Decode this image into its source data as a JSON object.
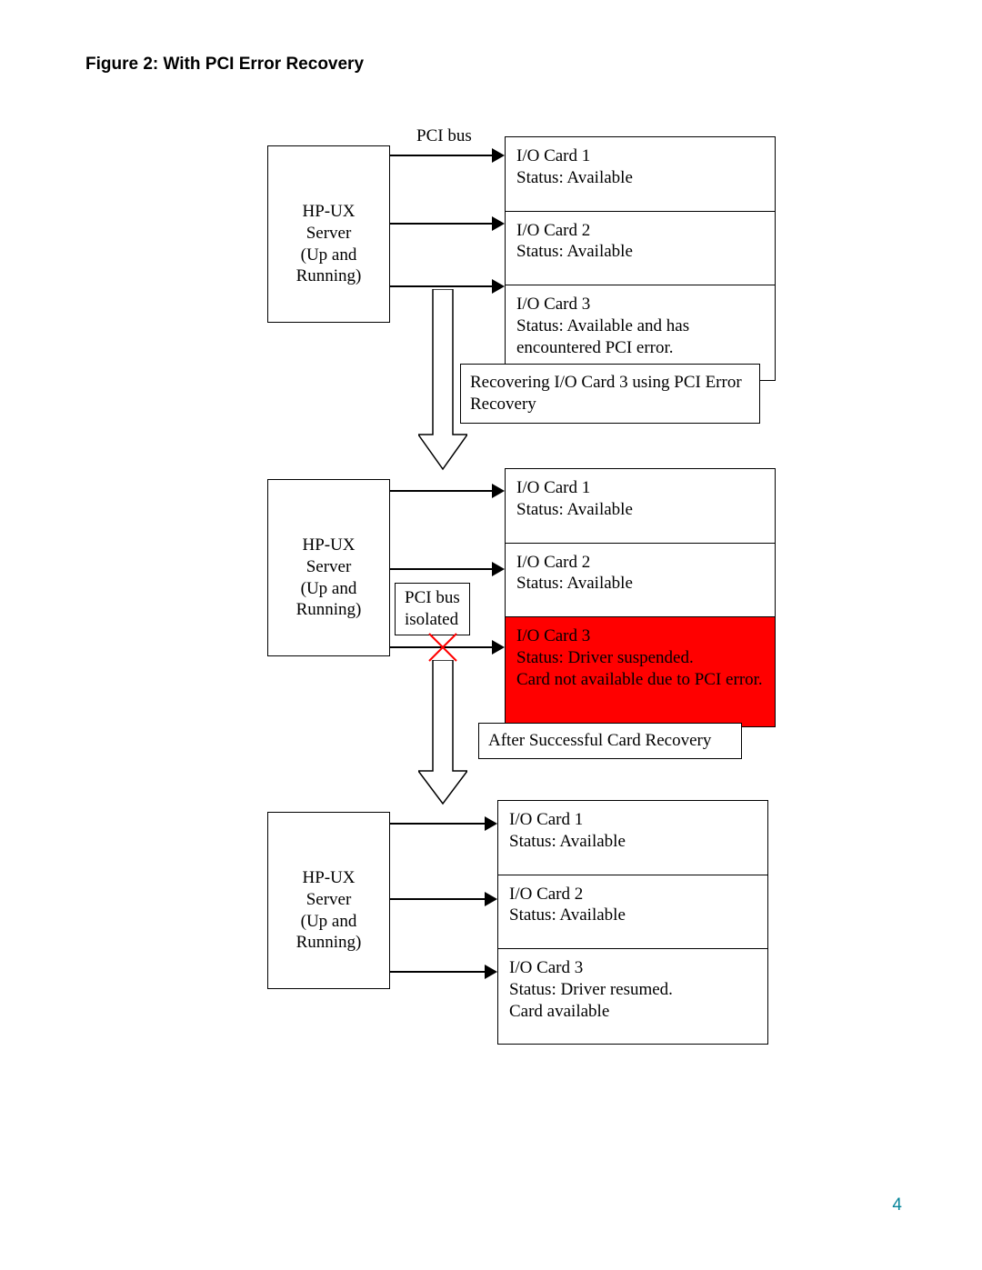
{
  "title": "Figure 2: With PCI Error Recovery",
  "page_number": "4",
  "server_label": "HP-UX\nServer\n(Up and\nRunning)",
  "pci_bus_label": "PCI bus",
  "pci_bus_isolated_label": "PCI bus\nisolated",
  "stage1": {
    "card1": "I/O Card 1\nStatus: Available",
    "card2": "I/O Card 2\nStatus: Available",
    "card3": "I/O Card 3\nStatus: Available and has\nencountered PCI error."
  },
  "recovering_label": "Recovering I/O Card 3 using PCI Error\nRecovery",
  "stage2": {
    "card1": "I/O Card 1\nStatus: Available",
    "card2": "I/O Card 2\nStatus: Available",
    "card3": "I/O Card 3\nStatus: Driver suspended.\nCard not available due to PCI error."
  },
  "after_label": "After Successful Card Recovery",
  "stage3": {
    "card1": "I/O Card 1\nStatus: Available",
    "card2": "I/O Card 2\nStatus: Available",
    "card3": "I/O Card 3\nStatus: Driver resumed.\nCard available"
  }
}
